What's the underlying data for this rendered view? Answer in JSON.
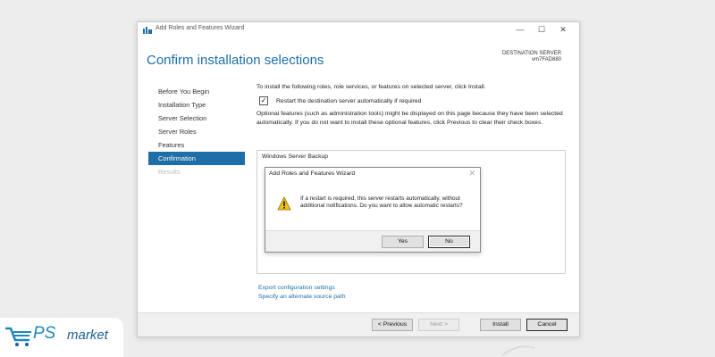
{
  "window": {
    "title": "Add Roles and Features Wizard",
    "controls": {
      "minimize": "—",
      "maximize": "☐",
      "close": "✕"
    }
  },
  "page": {
    "heading": "Confirm installation selections",
    "destination_label": "DESTINATION SERVER",
    "destination_value": "vm7FAD880"
  },
  "nav": {
    "items": [
      {
        "label": "Before You Begin",
        "state": "normal"
      },
      {
        "label": "Installation Type",
        "state": "normal"
      },
      {
        "label": "Server Selection",
        "state": "normal"
      },
      {
        "label": "Server Roles",
        "state": "normal"
      },
      {
        "label": "Features",
        "state": "normal"
      },
      {
        "label": "Confirmation",
        "state": "active"
      },
      {
        "label": "Results",
        "state": "disabled"
      }
    ]
  },
  "content": {
    "intro": "To install the following roles, role services, or features on selected server, click Install.",
    "restart_checkbox_label": "Restart the destination server automatically if required",
    "restart_checked": true,
    "optional_text": "Optional features (such as administration tools) might be displayed on this page because they have been selected automatically. If you do not want to install these optional features, click Previous to clear their check boxes.",
    "selected_items": [
      "Windows Server Backup"
    ]
  },
  "dialog": {
    "title": "Add Roles and Features Wizard",
    "message": "If a restart is required, this server restarts automatically, without additional notifications. Do you want to allow automatic restarts?",
    "yes_label": "Yes",
    "no_label": "No",
    "close_glyph": "✕"
  },
  "links": {
    "export": "Export configuration settings",
    "alternate_source": "Specify an alternate source path"
  },
  "footer": {
    "previous_label": "< Previous",
    "next_label": "Next >",
    "install_label": "Install",
    "cancel_label": "Cancel"
  },
  "watermark": {
    "ps": "PS",
    "market": "market"
  },
  "colors": {
    "accent": "#1e6ea8",
    "brand": "#1e88b8"
  }
}
